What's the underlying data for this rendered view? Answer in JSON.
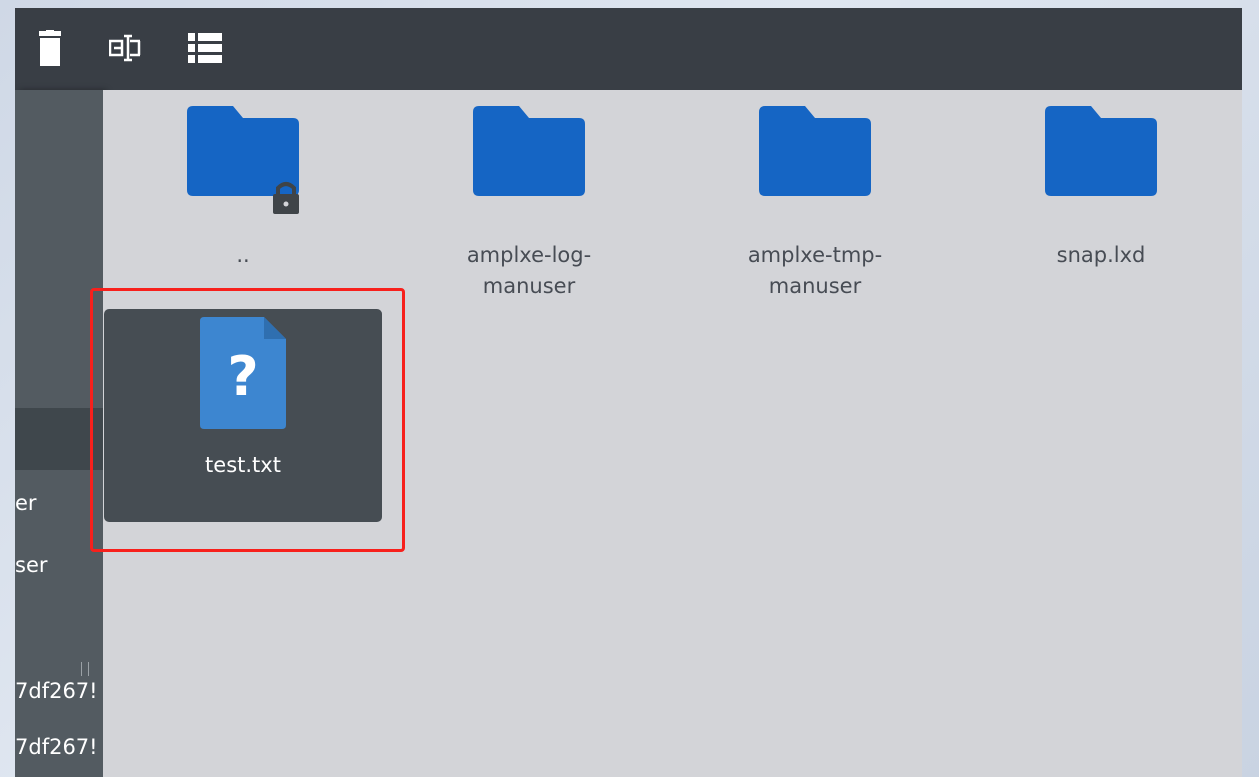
{
  "toolbar": {
    "icons": [
      "trash-icon",
      "rename-icon",
      "list-view-icon"
    ]
  },
  "sidebar": {
    "items": [
      {
        "label": "er"
      },
      {
        "label": "ser"
      },
      {
        "label": "7df267!"
      },
      {
        "label": "7df267!"
      }
    ]
  },
  "files": [
    {
      "name": "..",
      "type": "folder",
      "locked": true
    },
    {
      "name": "amplxe-log-manuser",
      "line1": "amplxe-log-",
      "line2": "manuser",
      "type": "folder"
    },
    {
      "name": "amplxe-tmp-manuser",
      "line1": "amplxe-tmp-",
      "line2": "manuser",
      "type": "folder"
    },
    {
      "name": "snap.lxd",
      "type": "folder"
    }
  ],
  "selected_file": {
    "name": "test.txt",
    "type": "unknown-file",
    "glyph": "?"
  },
  "colors": {
    "folder": "#1565c4",
    "file_icon": "#3d86d0",
    "selection_box": "#f7201c",
    "toolbar": "#393e45"
  }
}
